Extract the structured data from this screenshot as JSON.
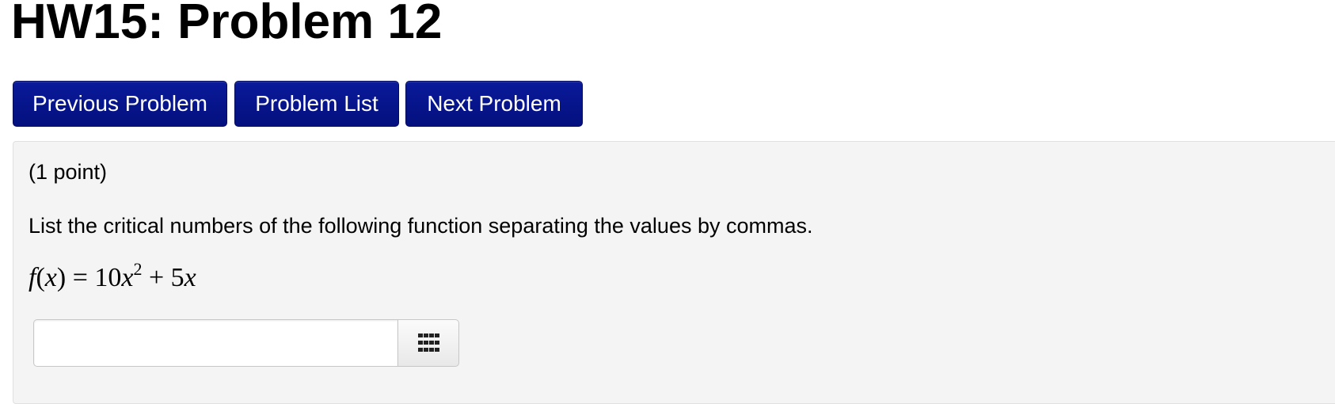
{
  "page": {
    "title": "HW15: Problem 12"
  },
  "nav": {
    "previous_label": "Previous Problem",
    "list_label": "Problem List",
    "next_label": "Next Problem"
  },
  "problem": {
    "points": "(1 point)",
    "question": "List the critical numbers of the following function separating the values by commas.",
    "formula": {
      "lhs_fn": "f",
      "lhs_open": "(",
      "lhs_var": "x",
      "lhs_close": ")",
      "equals": " = ",
      "coef1": "10",
      "var1": "x",
      "exp1": "2",
      "plus": " + ",
      "coef2": "5",
      "var2": "x"
    },
    "answer": {
      "value": "",
      "placeholder": ""
    },
    "keypad_icon": "keypad-grid-icon"
  },
  "colors": {
    "button_bg": "#03107e",
    "button_text": "#ffffff",
    "panel_bg": "#f4f4f4"
  }
}
